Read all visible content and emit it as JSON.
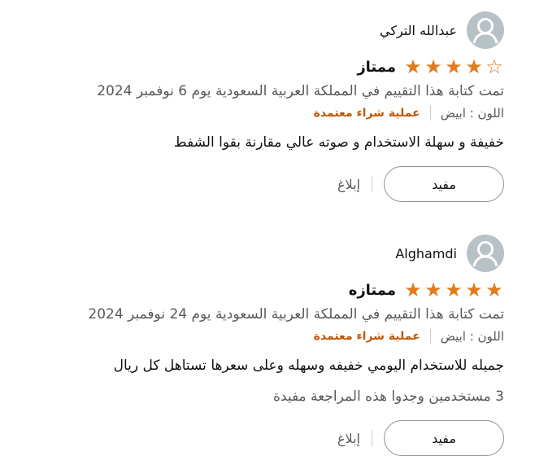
{
  "reviews": [
    {
      "name": "عبدالله التركي",
      "stars_filled": 4,
      "stars_total": 5,
      "headline": "ممتاز",
      "date": "تمت كتابة هذا التقييم في المملكة العربية السعودية يوم 6 نوفمبر 2024",
      "color_label": "اللون : ابيض",
      "verified": "عملية شراء معتمدة",
      "body": "خفيفة و سهلة الاستخدام و صوته عالي مقارنة بقوا الشفط",
      "helpful_label": "مفيد",
      "report_label": "إبلاغ"
    },
    {
      "name": "Alghamdi",
      "stars_filled": 5,
      "stars_total": 5,
      "headline": "ممتازه",
      "date": "تمت كتابة هذا التقييم في المملكة العربية السعودية يوم 24 نوفمبر 2024",
      "color_label": "اللون : ابيض",
      "verified": "عملية شراء معتمدة",
      "body": "جميله للاستخدام اليومي خفيفه وسهله وعلى سعرها تستاهل كل ريال",
      "helpful_count": "3 مستخدمين وجدوا هذه المراجعة مفيدة",
      "helpful_label": "مفيد",
      "report_label": "إبلاغ"
    }
  ],
  "colors": {
    "star": "#e07b1f",
    "verified": "#c45500",
    "avatar_bg": "#b7c1c6"
  },
  "icons": {
    "avatar": "default-user-avatar-icon",
    "star_full": "star-filled-icon",
    "star_empty": "star-outline-icon"
  }
}
